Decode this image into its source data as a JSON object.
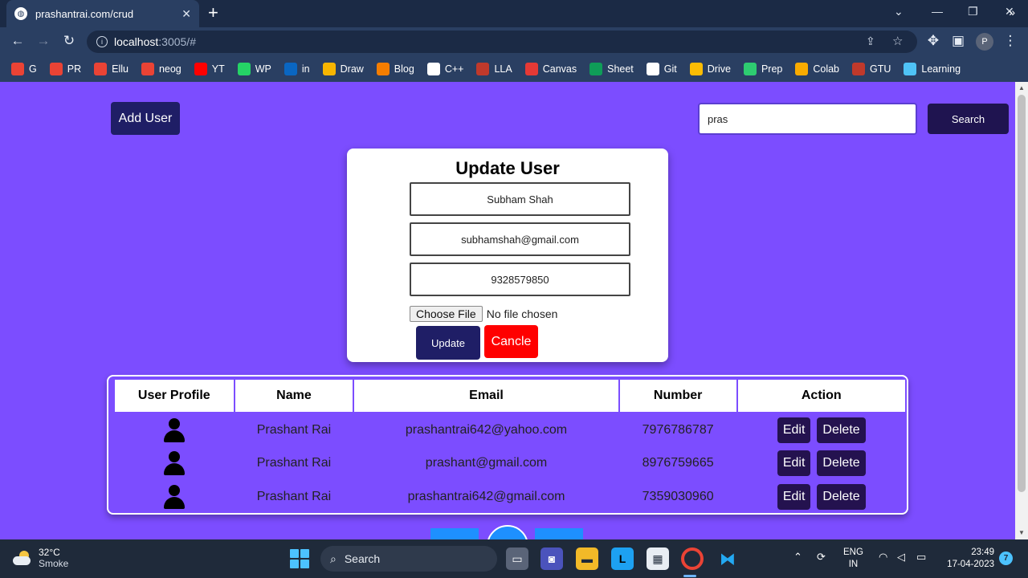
{
  "browser": {
    "tab_title": "prashantrai.com/crud",
    "url_host": "localhost",
    "url_rest": ":3005/#",
    "profile_initial": "P",
    "bookmarks": [
      {
        "label": "G",
        "icon": "gmail-icon",
        "color": "#ea4335"
      },
      {
        "label": "PR",
        "icon": "gmail-icon",
        "color": "#ea4335"
      },
      {
        "label": "Ellu",
        "icon": "gmail-icon",
        "color": "#ea4335"
      },
      {
        "label": "neog",
        "icon": "gmail-icon",
        "color": "#ea4335"
      },
      {
        "label": "YT",
        "icon": "youtube-icon",
        "color": "#ff0000"
      },
      {
        "label": "WP",
        "icon": "whatsapp-icon",
        "color": "#25d366"
      },
      {
        "label": "in",
        "icon": "linkedin-icon",
        "color": "#0a66c2"
      },
      {
        "label": "Draw",
        "icon": "draw-icon",
        "color": "#f7b500"
      },
      {
        "label": "Blog",
        "icon": "blogger-icon",
        "color": "#f57d00"
      },
      {
        "label": "C++",
        "icon": "cpp-icon",
        "color": "#ffffff"
      },
      {
        "label": "LLA",
        "icon": "lla-icon",
        "color": "#c0392b"
      },
      {
        "label": "Canvas",
        "icon": "canvas-icon",
        "color": "#e53935"
      },
      {
        "label": "Sheet",
        "icon": "sheets-icon",
        "color": "#0f9d58"
      },
      {
        "label": "Git",
        "icon": "github-icon",
        "color": "#ffffff"
      },
      {
        "label": "Drive",
        "icon": "drive-icon",
        "color": "#fbbc04"
      },
      {
        "label": "Prep",
        "icon": "prep-icon",
        "color": "#2ecc71"
      },
      {
        "label": "Colab",
        "icon": "colab-icon",
        "color": "#f9ab00"
      },
      {
        "label": "GTU",
        "icon": "gtu-icon",
        "color": "#c0392b"
      },
      {
        "label": "Learning",
        "icon": "learning-icon",
        "color": "#4fc3f7"
      }
    ],
    "bookmarks_more": "»"
  },
  "page": {
    "add_user_label": "Add User",
    "search_value": "pras",
    "search_label": "Search"
  },
  "modal": {
    "title": "Update User",
    "name_value": "Subham Shah",
    "email_value": "subhamshah@gmail.com",
    "number_value": "9328579850",
    "file_button_label": "Choose File",
    "file_status": "No file chosen",
    "update_label": "Update",
    "cancel_label": "Cancle"
  },
  "table": {
    "headers": [
      "User Profile",
      "Name",
      "Email",
      "Number",
      "Action"
    ],
    "rows": [
      {
        "name": "Prashant Rai",
        "email": "prashantrai642@yahoo.com",
        "number": "7976786787"
      },
      {
        "name": "Prashant Rai",
        "email": "prashant@gmail.com",
        "number": "8976759665"
      },
      {
        "name": "Prashant Rai",
        "email": "prashantrai642@gmail.com",
        "number": "7359030960"
      }
    ],
    "edit_label": "Edit",
    "delete_label": "Delete"
  },
  "taskbar": {
    "temperature": "32°C",
    "weather": "Smoke",
    "search_label": "Search",
    "lang_top": "ENG",
    "lang_bottom": "IN",
    "time": "23:49",
    "date": "17-04-2023",
    "notification_count": "7"
  },
  "colors": {
    "page_bg": "#7c4dff",
    "primary_button": "#1f1e66",
    "cancel_button": "#ff0000",
    "action_button": "#24124f"
  }
}
